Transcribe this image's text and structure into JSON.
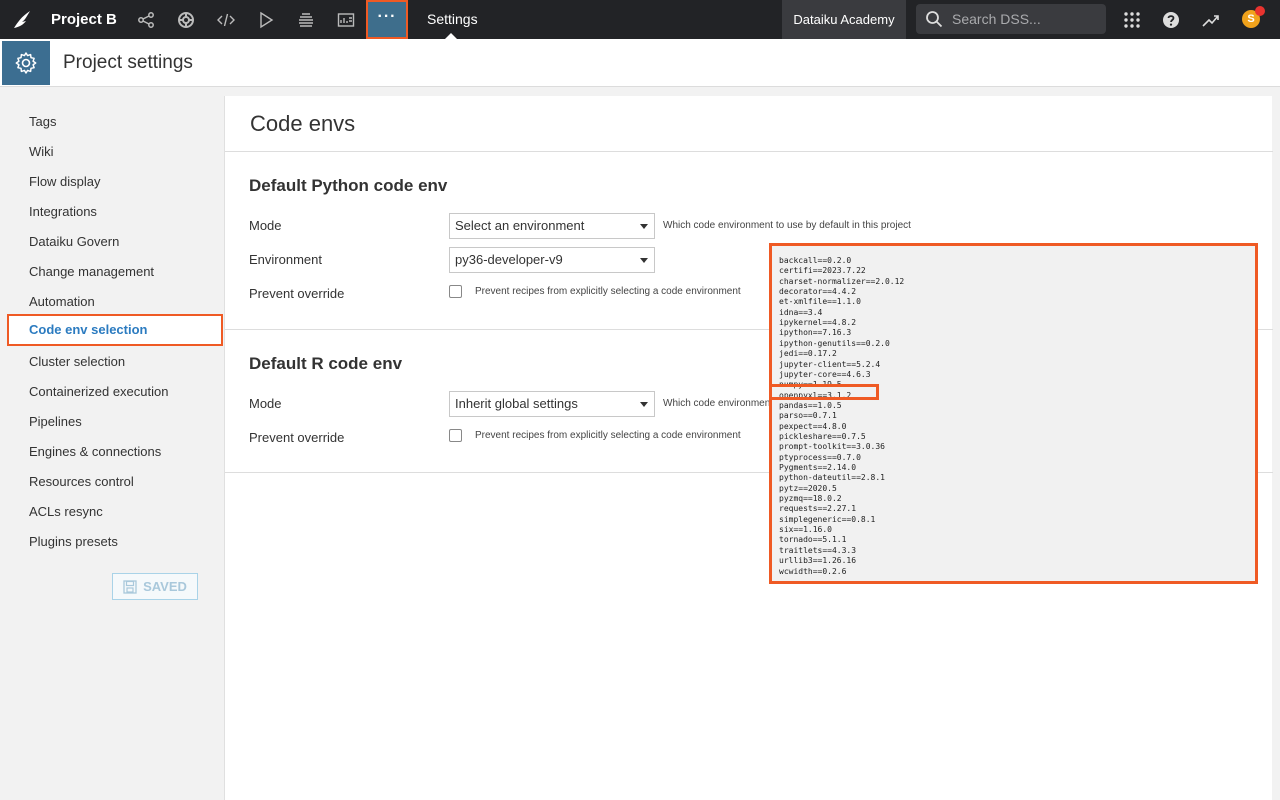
{
  "topbar": {
    "project_name": "Project B",
    "more_label": "···",
    "settings_label": "Settings",
    "academy_label": "Dataiku Academy",
    "search_placeholder": "Search DSS...",
    "avatar_initial": "S",
    "icons": [
      "dataiku-bird-logo",
      "flow-icon",
      "lifebuoy-icon",
      "code-icon",
      "play-icon",
      "stack-icon",
      "dashboard-icon",
      "more-icon",
      "search-icon",
      "apps-grid-icon",
      "help-icon",
      "trend-icon",
      "avatar"
    ]
  },
  "subheader": {
    "title": "Project settings"
  },
  "sidebar": {
    "items": [
      "Tags",
      "Wiki",
      "Flow display",
      "Integrations",
      "Dataiku Govern",
      "Change management",
      "Automation",
      "Code env selection",
      "Cluster selection",
      "Containerized execution",
      "Pipelines",
      "Engines & connections",
      "Resources control",
      "ACLs resync",
      "Plugins presets"
    ],
    "active_index": 7,
    "saved_label": "SAVED"
  },
  "main": {
    "title": "Code envs",
    "python": {
      "title": "Default Python code env",
      "mode_label": "Mode",
      "mode_value": "Select an environment",
      "mode_hint": "Which code environment to use by default in this project",
      "env_label": "Environment",
      "env_value": "py36-developer-v9",
      "override_label": "Prevent override",
      "override_text": "Prevent recipes from explicitly selecting a code environment"
    },
    "r": {
      "title": "Default R code env",
      "mode_label": "Mode",
      "mode_value": "Inherit global settings",
      "mode_hint": "Which code environmen",
      "override_label": "Prevent override",
      "override_text": "Prevent recipes from explicitly selecting a code environment"
    }
  },
  "packages": [
    "backcall==0.2.0",
    "certifi==2023.7.22",
    "charset-normalizer==2.0.12",
    "decorator==4.4.2",
    "et-xmlfile==1.1.0",
    "idna==3.4",
    "ipykernel==4.8.2",
    "ipython==7.16.3",
    "ipython-genutils==0.2.0",
    "jedi==0.17.2",
    "jupyter-client==5.2.4",
    "jupyter-core==4.6.3",
    "numpy==1.19.5",
    "openpyxl==3.1.2",
    "pandas==1.0.5",
    "parso==0.7.1",
    "pexpect==4.8.0",
    "pickleshare==0.7.5",
    "prompt-toolkit==3.0.36",
    "ptyprocess==0.7.0",
    "Pygments==2.14.0",
    "python-dateutil==2.8.1",
    "pytz==2020.5",
    "pyzmq==18.0.2",
    "requests==2.27.1",
    "simplegeneric==0.8.1",
    "six==1.16.0",
    "tornado==5.1.1",
    "traitlets==4.3.3",
    "urllib3==1.26.16",
    "wcwidth==0.2.6"
  ],
  "colors": {
    "accent": "#ef5a24",
    "topbar": "#222326",
    "brand_blue": "#3c6e91",
    "link_blue": "#2b7bc0"
  }
}
